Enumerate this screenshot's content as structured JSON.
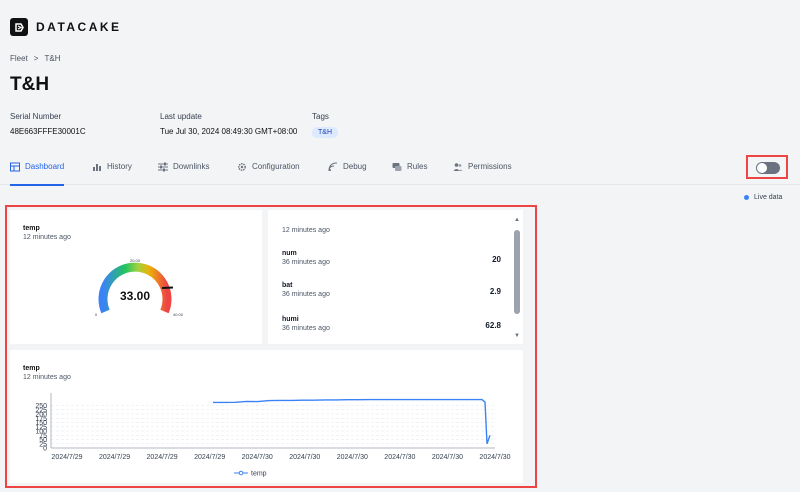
{
  "brand": {
    "name": "DATACAKE",
    "logo_icon": "datacake-logo-icon"
  },
  "breadcrumb": {
    "items": [
      "Fleet",
      "T&H"
    ],
    "separator": ">"
  },
  "device": {
    "title": "T&H"
  },
  "meta": {
    "serial": {
      "label": "Serial Number",
      "value": "48E663FFFE30001C"
    },
    "update": {
      "label": "Last update",
      "value": "Tue Jul 30, 2024 08:49:30 GMT+08:00"
    },
    "tags": {
      "label": "Tags",
      "values": [
        "T&H"
      ]
    }
  },
  "tabs": [
    {
      "label": "Dashboard",
      "icon": "dashboard-icon",
      "active": true
    },
    {
      "label": "History",
      "icon": "bar-chart-icon"
    },
    {
      "label": "Downlinks",
      "icon": "sliders-icon"
    },
    {
      "label": "Configuration",
      "icon": "gear-icon"
    },
    {
      "label": "Debug",
      "icon": "signal-icon"
    },
    {
      "label": "Rules",
      "icon": "rules-icon"
    },
    {
      "label": "Permissions",
      "icon": "users-icon"
    }
  ],
  "live_toggle": {
    "state": "off",
    "label": "off"
  },
  "live_data": {
    "label": "Live data"
  },
  "widgets": {
    "gauge": {
      "title": "temp",
      "subtitle": "12 minutes ago",
      "value": 33.0,
      "display": "33.00",
      "min": 0,
      "max": 40,
      "mid_label": "20.00",
      "min_label": "0",
      "max_label": "40.00"
    },
    "values": {
      "header": "12 minutes ago",
      "items": [
        {
          "name": "num",
          "time": "36 minutes ago",
          "value": "20"
        },
        {
          "name": "bat",
          "time": "36 minutes ago",
          "value": "2.9"
        },
        {
          "name": "humi",
          "time": "36 minutes ago",
          "value": "62.8"
        }
      ]
    },
    "line": {
      "title": "temp",
      "subtitle": "12 minutes ago"
    }
  },
  "chart_data": {
    "type": "line",
    "series": [
      {
        "name": "temp",
        "color": "#3b82f6",
        "values": [
          268,
          268,
          269,
          274,
          273,
          279,
          280,
          280,
          281,
          281,
          283,
          283,
          284,
          284,
          285,
          285,
          285,
          285,
          285,
          285,
          285,
          285,
          285,
          285,
          285,
          270,
          25,
          75
        ]
      }
    ],
    "x_tick_labels": [
      "2024/7/29",
      "2024/7/29",
      "2024/7/29",
      "2024/7/29",
      "2024/7/30",
      "2024/7/30",
      "2024/7/30",
      "2024/7/30",
      "2024/7/30",
      "2024/7/30"
    ],
    "y_ticks": [
      0,
      25,
      50,
      75,
      100,
      125,
      150,
      175,
      200,
      225,
      250
    ],
    "ylim": [
      0,
      300
    ],
    "grid": true,
    "legend": "bottom"
  }
}
